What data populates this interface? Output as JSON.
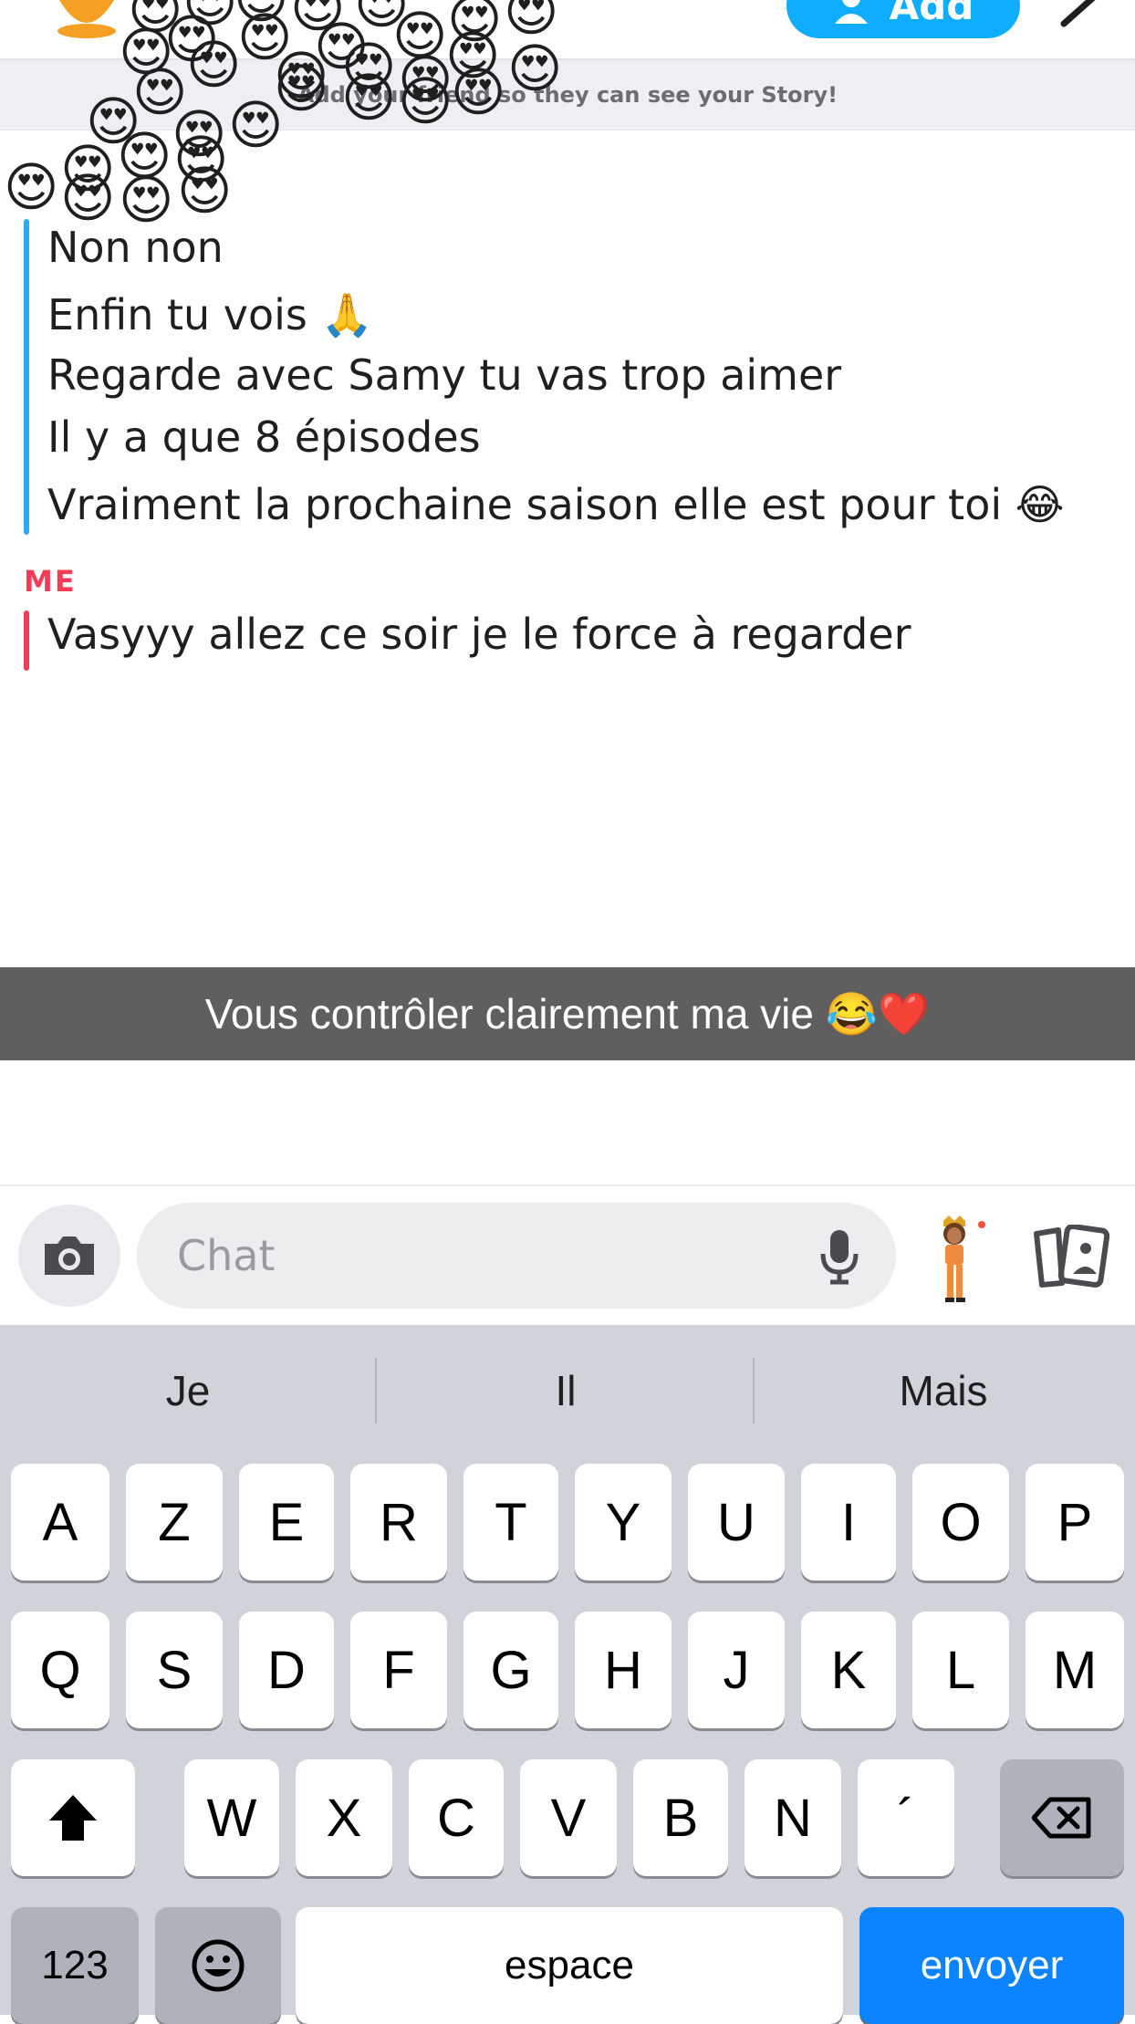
{
  "header": {
    "add_label": "Add",
    "story_banner": "Add your friend so they can see your Story!"
  },
  "stickers": {
    "emoji": "😍"
  },
  "chat": {
    "friend_messages": [
      "Non non",
      "Enfin tu vois 🙏",
      "Regarde avec Samy tu vas trop aimer",
      "Il y a que 8 épisodes",
      "Vraiment la prochaine saison elle est pour toi 😂"
    ],
    "me_label": "ME",
    "me_messages": [
      "Vasyyy allez ce soir je le force à regarder"
    ],
    "friend_color": "#2ea9f2",
    "me_color": "#f23c57"
  },
  "caption": "Vous contrôler clairement ma vie 😂❤️",
  "input": {
    "placeholder": "Chat"
  },
  "keyboard": {
    "suggestions": [
      "Je",
      "Il",
      "Mais"
    ],
    "row1": [
      "A",
      "Z",
      "E",
      "R",
      "T",
      "Y",
      "U",
      "I",
      "O",
      "P"
    ],
    "row2": [
      "Q",
      "S",
      "D",
      "F",
      "G",
      "H",
      "J",
      "K",
      "L",
      "M"
    ],
    "row3": [
      "W",
      "X",
      "C",
      "V",
      "B",
      "N",
      "´"
    ],
    "numbers_label": "123",
    "space_label": "espace",
    "send_label": "envoyer"
  },
  "colors": {
    "accent_blue": "#0fadff",
    "send_blue": "#0d84ff",
    "caption_bg": "#5f5f5f",
    "keyboard_bg": "#d0d3d9"
  }
}
